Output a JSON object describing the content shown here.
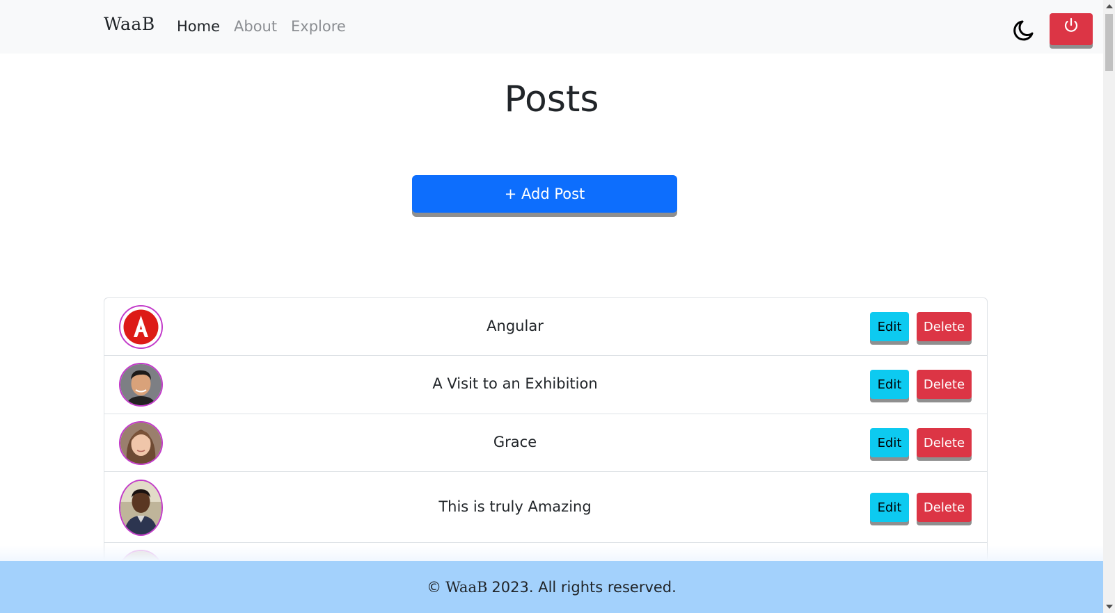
{
  "navbar": {
    "brand": "WaaB",
    "links": [
      {
        "label": "Home",
        "active": true
      },
      {
        "label": "About",
        "active": false
      },
      {
        "label": "Explore",
        "active": false
      }
    ],
    "theme_icon": "moon-icon",
    "logout_icon": "power-icon"
  },
  "main": {
    "title": "Posts",
    "add_button": "+ Add Post"
  },
  "posts": [
    {
      "title": "Angular",
      "avatar": "angular-logo",
      "edit": "Edit",
      "delete": "Delete"
    },
    {
      "title": "A Visit to an Exhibition",
      "avatar": "user-avatar-man",
      "edit": "Edit",
      "delete": "Delete"
    },
    {
      "title": "Grace",
      "avatar": "user-avatar-girl",
      "edit": "Edit",
      "delete": "Delete"
    },
    {
      "title": "This is truly Amazing",
      "avatar": "user-avatar-man-2",
      "edit": "Edit",
      "delete": "Delete"
    }
  ],
  "footer": {
    "copyright_symbol": "©",
    "brand": "WaaB",
    "text": "2023. All rights reserved."
  },
  "colors": {
    "primary": "#0d6efd",
    "info": "#0dcaf0",
    "danger": "#dc3545",
    "footer": "#a3d1fc",
    "avatar_border": "#c23ac9"
  }
}
